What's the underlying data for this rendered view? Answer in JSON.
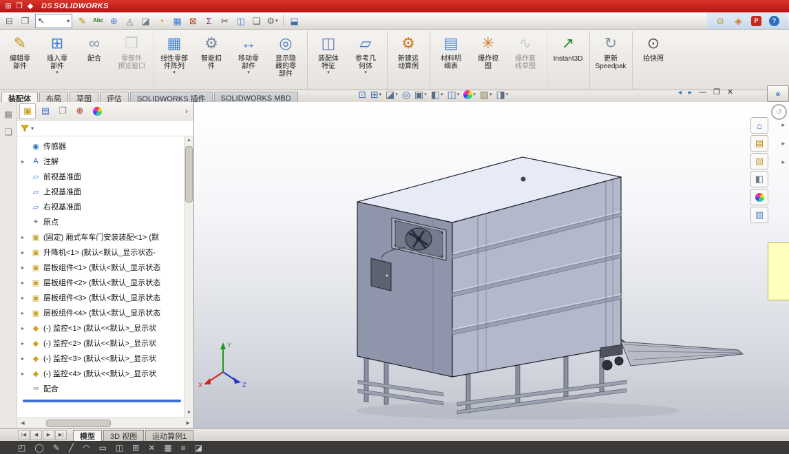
{
  "colors": {
    "titlebar_red": "#b81414",
    "accent_blue": "#3b6fd4",
    "model_lavender": "#b3b8cb"
  },
  "ui": {
    "caret": "▾",
    "expand_arrow": "▸",
    "chevron_right": "›",
    "up_arrow": "▲",
    "down_arrow": "▼",
    "left_arrow": "◀",
    "right_arrow": "▶"
  },
  "titlebar": {
    "app_name": "SOLIDWORKS",
    "logo_mark": "DS",
    "icons": [
      {
        "name": "window-grid-icon",
        "glyph": "⊞"
      },
      {
        "name": "new-window-icon",
        "glyph": "❐"
      },
      {
        "name": "app-icon",
        "glyph": "◆"
      }
    ]
  },
  "menubar": {
    "left": [
      {
        "name": "open-document-icon",
        "glyph": "⊟",
        "color": "#6b6f75"
      },
      {
        "name": "tile-windows-icon",
        "glyph": "❐",
        "color": "#6b6f75"
      }
    ],
    "select": {
      "name": "select-tool",
      "glyph": "↖",
      "caret": "▾"
    },
    "main": [
      {
        "name": "paint-icon",
        "glyph": "✎",
        "color": "#b58500"
      },
      {
        "name": "spell-check-icon",
        "glyph": "Abc",
        "color": "#2a7a2a",
        "txt": true
      },
      {
        "name": "measure-icon",
        "glyph": "⊕",
        "color": "#3b7bd4"
      },
      {
        "name": "mass-properties-icon",
        "glyph": "◬",
        "color": "#6b7d92"
      },
      {
        "name": "section-properties-icon",
        "glyph": "◪",
        "color": "#6b7d92"
      },
      {
        "name": "performance-icon",
        "glyph": "◔",
        "color": "#b8860b"
      },
      {
        "name": "assembly-visualization-icon",
        "glyph": "▦",
        "color": "#3b7bd4"
      },
      {
        "name": "interference-detection-icon",
        "glyph": "⊠",
        "color": "#b0522a"
      },
      {
        "name": "equations-icon",
        "glyph": "Σ",
        "color": "#7a2a7a"
      },
      {
        "name": "trim-icon",
        "glyph": "✂",
        "color": "#555555"
      },
      {
        "name": "mirror-icon",
        "glyph": "◫",
        "color": "#3b7bd4"
      },
      {
        "name": "copy-icon",
        "glyph": "❏",
        "color": "#555555"
      },
      {
        "name": "options-icon",
        "glyph": "⚙",
        "color": "#666666",
        "dropdown": true
      },
      {
        "sep": true,
        "glyph": ""
      },
      {
        "name": "screen-capture-icon",
        "glyph": "⬓",
        "color": "#3b6fae"
      }
    ],
    "right": [
      {
        "name": "search-icon",
        "glyph": "⊙",
        "color": "#b8860b"
      },
      {
        "name": "edrawings-icon",
        "glyph": "◈",
        "color": "#d07818"
      },
      {
        "name": "pdf-export-icon",
        "glyph": "P",
        "color": "#ffffff",
        "bg": "#c42a1c",
        "boxed": true
      },
      {
        "name": "web-help-icon",
        "glyph": "?",
        "color": "#ffffff",
        "bg": "#2a6fbd",
        "boxed": true,
        "round": true
      }
    ]
  },
  "ribbon": {
    "buttons": [
      {
        "name": "edit-component-button",
        "label": "编辑零\n部件",
        "glyph": "✎",
        "color": "#c89314"
      },
      {
        "name": "insert-component-button",
        "label": "插入零\n部件",
        "glyph": "⊞",
        "color": "#3b7bd4",
        "dropdown": true
      },
      {
        "name": "mate-button",
        "label": "配合",
        "glyph": "∞",
        "color": "#8694a8"
      },
      {
        "name": "component-preview-window-button",
        "label": "零部件\n预览窗口",
        "glyph": "❒",
        "color": "#9aa0a8",
        "disabled": true,
        "sep": true
      },
      {
        "name": "linear-component-pattern-button",
        "label": "线性零部\n件阵列",
        "glyph": "▦",
        "color": "#3b7bd4",
        "dropdown": true
      },
      {
        "name": "smart-fasteners-button",
        "label": "智能扣\n件",
        "glyph": "⚙",
        "color": "#7a8aa0"
      },
      {
        "name": "move-component-button",
        "label": "移动零\n部件",
        "glyph": "↔",
        "color": "#3b7bd4",
        "dropdown": true
      },
      {
        "name": "show-hidden-components-button",
        "label": "显示隐\n藏的零\n部件",
        "glyph": "◎",
        "color": "#4a7dbd",
        "sep": true
      },
      {
        "name": "assembly-features-button",
        "label": "装配体\n特征",
        "glyph": "◫",
        "color": "#5a7dbd",
        "dropdown": true
      },
      {
        "name": "reference-geometry-button",
        "label": "参考几\n何体",
        "glyph": "▱",
        "color": "#3b7bd4",
        "dropdown": true,
        "sep": true
      },
      {
        "name": "new-motion-study-button",
        "label": "新建运\n动算例",
        "glyph": "⚙",
        "color": "#d07818",
        "sep": true
      },
      {
        "name": "bill-of-materials-button",
        "label": "材料明\n细表",
        "glyph": "▤",
        "color": "#3b7bd4"
      },
      {
        "name": "exploded-view-button",
        "label": "爆炸视\n图",
        "glyph": "✳",
        "color": "#c87d2e"
      },
      {
        "name": "explode-line-sketch-button",
        "label": "爆炸直\n线草图",
        "glyph": "∿",
        "color": "#9aa0a8",
        "disabled": true,
        "sep": true
      },
      {
        "name": "instant3d-button",
        "label": "Instant3D",
        "glyph": "↗",
        "color": "#2a8a2a",
        "sep": true
      },
      {
        "name": "update-speedpak-button",
        "label": "更新\nSpeedpak",
        "glyph": "↻",
        "color": "#8694a8",
        "sep": true
      },
      {
        "name": "take-snapshot-button",
        "label": "拍快照",
        "glyph": "⊙",
        "color": "#555555"
      }
    ]
  },
  "cmd_tabs": {
    "items": [
      {
        "name": "tab-assembly",
        "label": "装配体",
        "active": true
      },
      {
        "name": "tab-layout",
        "label": "布局"
      },
      {
        "name": "tab-sketch",
        "label": "草图"
      },
      {
        "name": "tab-evaluate",
        "label": "评估"
      },
      {
        "name": "tab-sw-addins",
        "label": "SOLIDWORKS 插件",
        "alt": true
      },
      {
        "name": "tab-sw-mbd",
        "label": "SOLIDWORKS MBD",
        "alt": true
      }
    ]
  },
  "hud": {
    "icons": [
      {
        "name": "zoom-fit-icon",
        "glyph": "⊡",
        "color": "#3b6fae"
      },
      {
        "name": "zoom-area-icon",
        "glyph": "⊞",
        "color": "#3b6fae",
        "caret": true
      },
      {
        "name": "section-view-icon",
        "glyph": "◪",
        "color": "#5a6f86",
        "caret": true
      },
      {
        "name": "dynamic-annotation-icon",
        "glyph": "◎",
        "color": "#3b6fae"
      },
      {
        "name": "view-orientation-icon",
        "glyph": "▣",
        "color": "#5a6f86",
        "caret": true
      },
      {
        "name": "display-style-icon",
        "glyph": "◧",
        "color": "#5a6f86",
        "caret": true
      },
      {
        "name": "hide-show-items-icon",
        "glyph": "◫",
        "color": "#3b6fae",
        "caret": true
      },
      {
        "name": "edit-appearance-icon",
        "ball": true,
        "caret": true
      },
      {
        "name": "apply-scene-icon",
        "glyph": "▨",
        "color": "#8a7a5a",
        "caret": true
      },
      {
        "name": "view-settings-icon",
        "glyph": "◨",
        "color": "#5a6f86",
        "caret": true
      }
    ]
  },
  "window_controls": {
    "back": "◂",
    "forward": "▸",
    "minimize": "—",
    "restore": "❐",
    "close": "✕",
    "collapse": "«",
    "refresh": "↺"
  },
  "left_rail": {
    "icons": [
      {
        "name": "collapsed-toolbar-icon",
        "glyph": "▦"
      },
      {
        "name": "collapsed-panel-icon",
        "glyph": "❏"
      }
    ]
  },
  "feature_panel": {
    "header_icons": [
      {
        "name": "featuremanager-tab",
        "glyph": "▣",
        "color": "#c9a227",
        "active": true
      },
      {
        "name": "propertymanager-tab",
        "glyph": "▤",
        "color": "#3b7bd4"
      },
      {
        "name": "configurationmanager-tab",
        "glyph": "❐",
        "color": "#888888"
      },
      {
        "name": "dimxpert-tab",
        "glyph": "⊕",
        "color": "#b03a2e"
      },
      {
        "name": "displaymanager-tab",
        "ball": true
      }
    ],
    "tree": {
      "items": [
        {
          "icon": "sensors-icon",
          "glyph": "◉",
          "color": "#2a6fbd",
          "label": "传感器"
        },
        {
          "icon": "annotations-icon",
          "glyph": "A",
          "color": "#1a66cc",
          "label": "注解",
          "expand": true
        },
        {
          "icon": "plane-icon",
          "glyph": "▱",
          "color": "#3b7bd4",
          "label": "前视基准面"
        },
        {
          "icon": "plane-icon",
          "glyph": "▱",
          "color": "#3b7bd4",
          "label": "上视基准面"
        },
        {
          "icon": "plane-icon",
          "glyph": "▱",
          "color": "#3b7bd4",
          "label": "右视基准面"
        },
        {
          "icon": "origin-icon",
          "glyph": "⌖",
          "color": "#444444",
          "label": "原点"
        },
        {
          "icon": "subassembly-icon",
          "glyph": "▣",
          "color": "#c9a227",
          "label": "(固定) 厢式车车门安装装配<1> (默",
          "expand": true
        },
        {
          "icon": "subassembly-icon",
          "glyph": "▣",
          "color": "#c9a227",
          "label": "升降机<1> (默认<默认_显示状态-",
          "expand": true
        },
        {
          "icon": "subassembly-icon",
          "glyph": "▣",
          "color": "#c9a227",
          "label": "层板组件<1> (默认<默认_显示状态",
          "expand": true
        },
        {
          "icon": "subassembly-icon",
          "glyph": "▣",
          "color": "#c9a227",
          "label": "层板组件<2> (默认<默认_显示状态",
          "expand": true
        },
        {
          "icon": "subassembly-icon",
          "glyph": "▣",
          "color": "#c9a227",
          "label": "层板组件<3> (默认<默认_显示状态",
          "expand": true
        },
        {
          "icon": "subassembly-icon",
          "glyph": "▣",
          "color": "#c9a227",
          "label": "层板组件<4> (默认<默认_显示状态",
          "expand": true
        },
        {
          "icon": "part-icon",
          "glyph": "◆",
          "color": "#d4a017",
          "label": "(-) 监控<1> (默认<<默认>_显示状",
          "expand": true
        },
        {
          "icon": "part-icon",
          "glyph": "◆",
          "color": "#d4a017",
          "label": "(-) 监控<2> (默认<<默认>_显示状",
          "expand": true
        },
        {
          "icon": "part-icon",
          "glyph": "◆",
          "color": "#d4a017",
          "label": "(-) 监控<3> (默认<<默认>_显示状",
          "expand": true
        },
        {
          "icon": "part-icon",
          "glyph": "◆",
          "color": "#d4a017",
          "label": "(-) 监控<4> (默认<<默认>_显示状",
          "expand": true
        },
        {
          "icon": "mates-icon",
          "glyph": "∞",
          "color": "#7a8699",
          "label": "配合"
        }
      ]
    }
  },
  "taskpane": {
    "icons": [
      {
        "name": "solidworks-resources-icon",
        "glyph": "⌂",
        "color": "#2a6fbd"
      },
      {
        "name": "design-library-icon",
        "glyph": "▤",
        "color": "#b8860b"
      },
      {
        "name": "file-explorer-icon",
        "glyph": "▧",
        "color": "#caa03c"
      },
      {
        "name": "view-palette-icon",
        "glyph": "◧",
        "color": "#6a7a8a"
      },
      {
        "name": "appearances-icon",
        "ball": true
      },
      {
        "name": "custom-properties-icon",
        "glyph": "▥",
        "color": "#4a7dbd"
      }
    ]
  },
  "viewport": {
    "triad": {
      "x": "X",
      "y": "Y",
      "z": "Z"
    }
  },
  "bottom": {
    "nav": [
      "|◀",
      "◀",
      "▶",
      "▶|"
    ],
    "tabs": [
      {
        "name": "tab-model",
        "label": "模型",
        "active": true
      },
      {
        "name": "tab-3d-views",
        "label": "3D 视图"
      },
      {
        "name": "tab-motion-study-1",
        "label": "运动算例1"
      }
    ]
  },
  "statusbar": {
    "icons": [
      "◰",
      "◯",
      "✎",
      "╱",
      "◠",
      "▭",
      "◫",
      "⊞",
      "✕",
      "▦",
      "≡",
      "◪"
    ]
  }
}
